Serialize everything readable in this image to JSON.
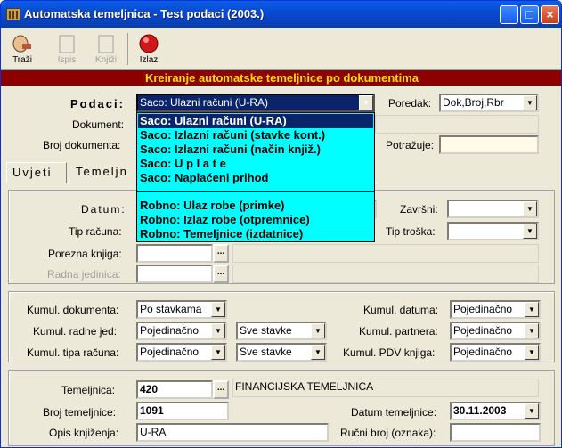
{
  "window": {
    "title": "Automatska temeljnica - Test podaci (2003.)"
  },
  "toolbar": {
    "trazi": "Traži",
    "ispis": "Ispis",
    "knjizi": "Knjiži",
    "izlaz": "Izlaz"
  },
  "banner": "Kreiranje automatske temeljnice po dokumentima",
  "podaci": {
    "label": "Podaci:",
    "value": "Saco: Ulazni računi (U-RA)"
  },
  "poredak": {
    "label": "Poredak:",
    "value": "Dok,Broj,Rbr"
  },
  "dokument": {
    "label": "Dokument:"
  },
  "broj_dokumenta": {
    "label": "Broj dokumenta:"
  },
  "potrazuje": {
    "label": "Potražuje:"
  },
  "tabs": {
    "uvjeti": "Uvjeti",
    "temeljnica": "Temeljn"
  },
  "dropdown": {
    "items": [
      "Saco: Ulazni računi (U-RA)",
      "Saco: Izlazni računi (stavke kont.)",
      "Saco: Izlazni računi (način knjiž.)",
      "Saco: U p l a t e",
      "Saco: Naplaćeni prihod",
      "Robno: Ulaz robe (primke)",
      "Robno: Izlaz robe (otpremnice)",
      "Robno: Temeljnice (izdatnice)"
    ]
  },
  "uvjeti": {
    "datum": "Datum:",
    "zavrsni": "Završni:",
    "tip_racuna": "Tip računa:",
    "tip_troska": "Tip troška:",
    "porezna_knjiga": "Porezna knjiga:",
    "radna_jedinica": "Radna jedinica:"
  },
  "kumul": {
    "dokumenta_label": "Kumul. dokumenta:",
    "dokumenta_value": "Po stavkama",
    "radne_jed_label": "Kumul. radne jed:",
    "radne_jed_value": "Pojedinačno",
    "radne_jed_stavke": "Sve stavke",
    "tipa_racuna_label": "Kumul. tipa računa:",
    "tipa_racuna_value": "Pojedinačno",
    "tipa_racuna_stavke": "Sve stavke",
    "datuma_label": "Kumul. datuma:",
    "datuma_value": "Pojedinačno",
    "partnera_label": "Kumul. partnera:",
    "partnera_value": "Pojedinačno",
    "pdv_label": "Kumul. PDV knjiga:",
    "pdv_value": "Pojedinačno"
  },
  "temeljnica": {
    "label": "Temeljnica:",
    "code": "420",
    "name": "FINANCIJSKA TEMELJNICA",
    "broj_label": "Broj temeljnice:",
    "broj_value": "1091",
    "datum_label": "Datum temeljnice:",
    "datum_value": "30.11.2003",
    "opis_label": "Opis knjiženja:",
    "opis_value": "U-RA",
    "rucni_label": "Ručni broj (oznaka):"
  },
  "colors": {
    "banner_bg": "#8c0000",
    "banner_fg": "#ffe000",
    "dropdown_bg": "#00ffff",
    "highlight": "#0a246a"
  }
}
